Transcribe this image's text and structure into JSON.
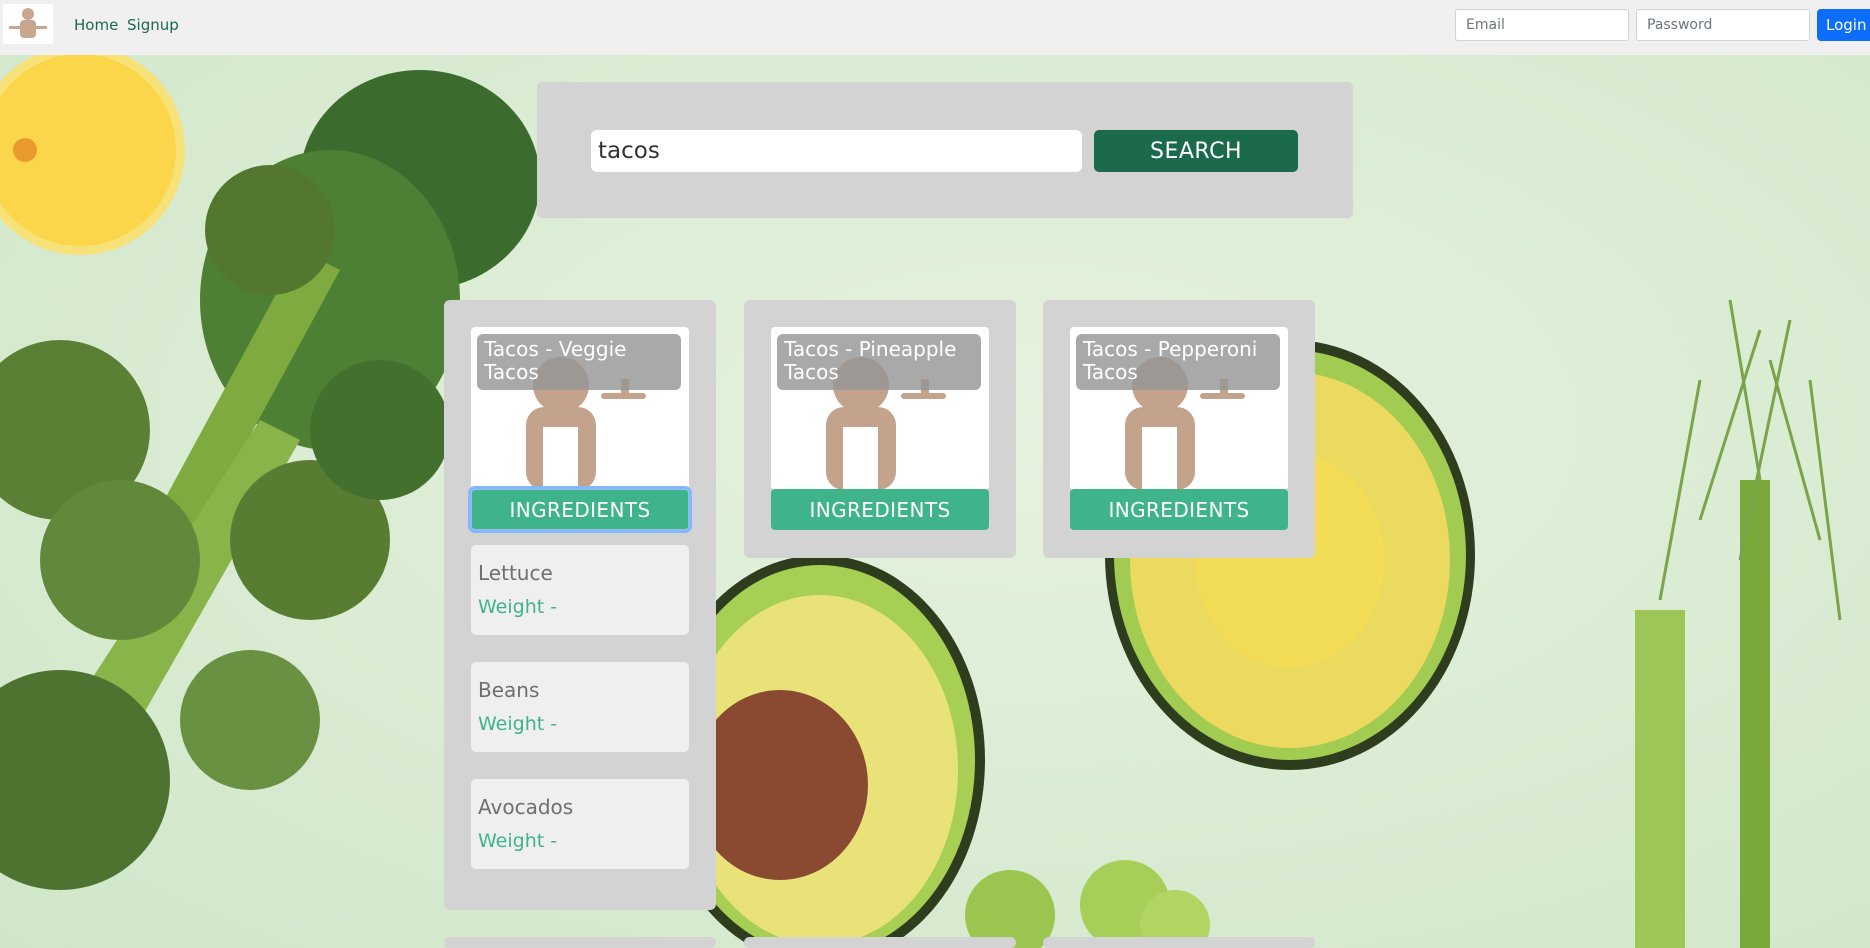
{
  "nav": {
    "links": [
      "Home",
      "Signup"
    ],
    "email_placeholder": "Email",
    "password_placeholder": "Password",
    "login_label": "Login"
  },
  "search": {
    "value": "tacos",
    "button_label": "SEARCH"
  },
  "recipes": [
    {
      "title": "Tacos - Veggie Tacos",
      "button_label": "INGREDIENTS",
      "ingredients": [
        {
          "name": "Lettuce",
          "weight": "Weight -"
        },
        {
          "name": "Beans",
          "weight": "Weight -"
        },
        {
          "name": "Avocados",
          "weight": "Weight -"
        }
      ]
    },
    {
      "title": "Tacos - Pineapple Tacos",
      "button_label": "INGREDIENTS",
      "ingredients": []
    },
    {
      "title": "Tacos - Pepperoni Tacos",
      "button_label": "INGREDIENTS",
      "ingredients": []
    }
  ],
  "icons": {
    "logo": "chef-logo-icon",
    "thumbnail": "chef-icon"
  },
  "colors": {
    "brand_green": "#1b6a4c",
    "accent_green": "#3fb38a",
    "login_blue": "#0d6efd",
    "panel_gray": "#d3d3d3"
  }
}
